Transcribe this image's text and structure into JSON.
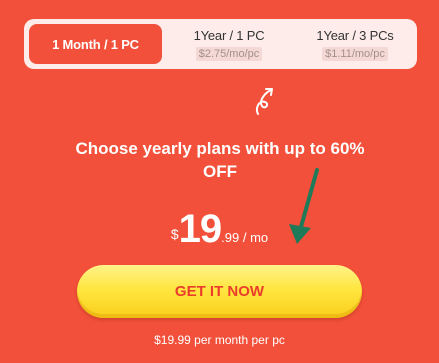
{
  "plans": [
    {
      "title": "1 Month / 1 PC",
      "price": "",
      "active": true
    },
    {
      "title": "1Year / 1 PC",
      "price": "$2.75/mo/pc",
      "active": false
    },
    {
      "title": "1Year / 3 PCs",
      "price": "$1.11/mo/pc",
      "active": false
    }
  ],
  "headline": "Choose yearly plans with up to 60% OFF",
  "price": {
    "currency": "$",
    "whole": "19",
    "fraction": ".99 / mo"
  },
  "cta_label": "GET IT NOW",
  "footnote": "$19.99 per month per pc",
  "colors": {
    "background": "#f2503a",
    "accent_green": "#1e7a58",
    "cta": "#ffe640"
  },
  "icons": [
    "curly-arrow-icon",
    "green-arrow-icon"
  ]
}
